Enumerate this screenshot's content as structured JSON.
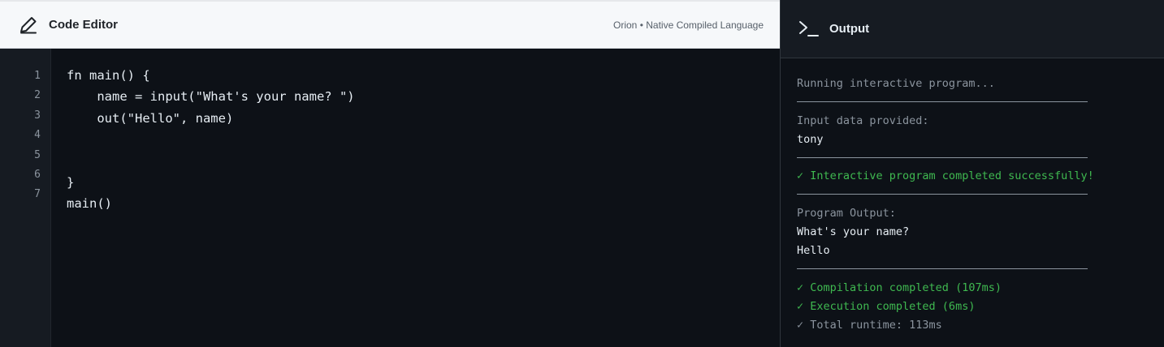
{
  "editor": {
    "title": "Code Editor",
    "subtitle": "Orion • Native Compiled Language",
    "icon": "pencil-icon",
    "line_numbers": [
      "1",
      "2",
      "3",
      "4",
      "5",
      "6",
      "7"
    ],
    "code_lines": [
      "fn main() {",
      "    name = input(\"What's your name? \")",
      "    out(\"Hello\", name)",
      "",
      "",
      "}",
      "main()"
    ]
  },
  "output": {
    "title": "Output",
    "icon": "terminal-icon",
    "running": "Running interactive program...",
    "input_label": "Input data provided:",
    "input_value": "tony",
    "success": "✓ Interactive program completed successfully!",
    "program_output_label": "Program Output:",
    "program_output": [
      "What's your name?",
      "Hello"
    ],
    "compile": "✓ Compilation completed (107ms)",
    "execute": "✓ Execution completed (6ms)",
    "runtime": "✓ Total runtime: 113ms"
  },
  "colors": {
    "background": "#0d1117",
    "success": "#3fb950",
    "muted": "#8b949e"
  }
}
